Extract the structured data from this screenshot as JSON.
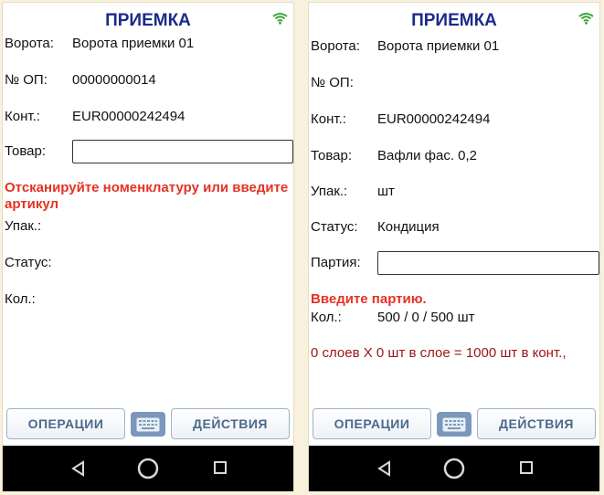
{
  "colors": {
    "title": "#1b2a8c",
    "message": "#e53224",
    "note": "#9a1414",
    "wifi": "#3aa53a",
    "button_text": "#4a6a8c",
    "keyboard": "#7b97bc",
    "navbar": "#000000"
  },
  "icons": [
    "wifi-icon",
    "keyboard-icon",
    "back-icon",
    "home-icon",
    "recents-icon"
  ],
  "screen1": {
    "title": "ПРИЕМКА",
    "gate": {
      "label": "Ворота:",
      "value": "Ворота приемки 01"
    },
    "op": {
      "label": "№ ОП:",
      "value": "00000000014"
    },
    "container": {
      "label": "Конт.:",
      "value": "EUR00000242494"
    },
    "product": {
      "label": "Товар:",
      "placeholder": ""
    },
    "message": "Отсканируйте номенклатуру или введите артикул",
    "pack": {
      "label": "Упак.:"
    },
    "status": {
      "label": "Статус:"
    },
    "qty": {
      "label": "Кол.:"
    },
    "buttons": {
      "operations": "ОПЕРАЦИИ",
      "actions": "ДЕЙСТВИЯ"
    }
  },
  "screen2": {
    "title": "ПРИЕМКА",
    "gate": {
      "label": "Ворота:",
      "value": "Ворота приемки 01"
    },
    "op": {
      "label": "№ ОП:"
    },
    "container": {
      "label": "Конт.:",
      "value": "EUR00000242494"
    },
    "product": {
      "label": "Товар:",
      "value": "Вафли фас. 0,2"
    },
    "pack": {
      "label": "Упак.:",
      "value": "шт"
    },
    "status": {
      "label": "Статус:",
      "value": "Кондиция"
    },
    "batch": {
      "label": "Партия:",
      "placeholder": ""
    },
    "message": "Введите партию.",
    "qty": {
      "label": "Кол.:",
      "value": "500 / 0 / 500 шт"
    },
    "layers_note": "0 слоев X 0 шт в слое = 1000 шт в конт.,",
    "buttons": {
      "operations": "ОПЕРАЦИИ",
      "actions": "ДЕЙСТВИЯ"
    }
  }
}
